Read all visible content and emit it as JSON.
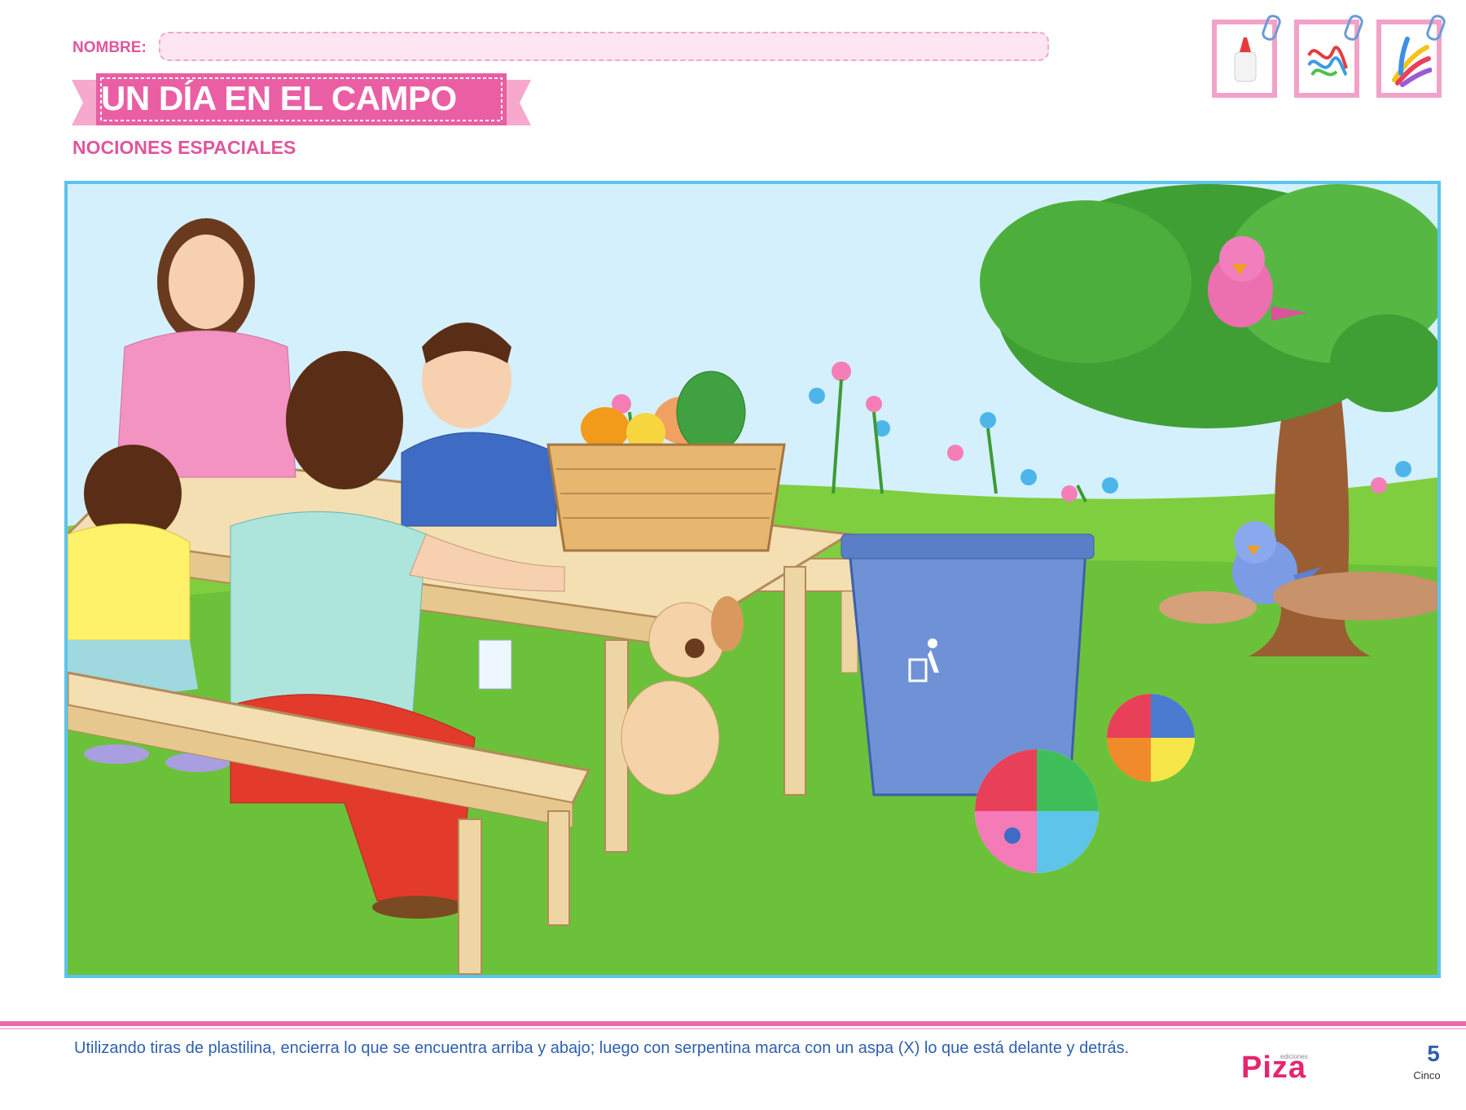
{
  "header": {
    "name_label": "NOMBRE:",
    "title": "UN DÍA EN EL CAMPO",
    "subtitle": "NOCIONES ESPACIALES"
  },
  "materials": [
    {
      "icon": "glue-bottle-icon"
    },
    {
      "icon": "streamer-icon"
    },
    {
      "icon": "plasticine-strips-icon"
    }
  ],
  "scene": {
    "description_elements": [
      "family",
      "picnic-table",
      "fruit-basket",
      "dog",
      "trash-bin",
      "beach-balls",
      "tree",
      "birds",
      "flowers"
    ],
    "bin_symbol": "recycle-person-icon"
  },
  "footer": {
    "instruction": "Utilizando tiras de plastilina, encierra lo que se encuentra arriba y abajo; luego con serpentina marca con un aspa (X) lo que está delante y detrás.",
    "publisher_small": "ediciones",
    "publisher": "Piza",
    "page_number": "5",
    "page_word": "Cinco"
  },
  "colors": {
    "accent_pink": "#e0559b",
    "frame_blue": "#5bc4ee",
    "text_blue": "#2e5fb0"
  }
}
